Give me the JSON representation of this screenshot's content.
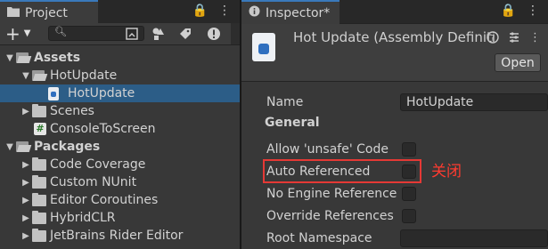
{
  "project": {
    "tab_label": "Project",
    "tab_tools": [
      "🔒",
      "⋮"
    ],
    "add_label": "+",
    "search": {
      "value": "",
      "placeholder": ""
    },
    "badge_count": "",
    "tree": [
      {
        "label": "Assets",
        "bold": true,
        "expanded": true,
        "icon": "folder-open"
      },
      {
        "label": "HotUpdate",
        "bold": false,
        "expanded": true,
        "icon": "folder-open"
      },
      {
        "label": "HotUpdate",
        "bold": false,
        "expanded": false,
        "icon": "assembly-definition-icon",
        "selected": true
      },
      {
        "label": "Scenes",
        "bold": false,
        "expanded": false,
        "icon": "folder"
      },
      {
        "label": "ConsoleToScreen",
        "bold": false,
        "expanded": false,
        "icon": "csharp-script-icon"
      },
      {
        "label": "Packages",
        "bold": true,
        "expanded": true,
        "icon": "folder-open"
      },
      {
        "label": "Code Coverage",
        "bold": false,
        "expanded": false,
        "icon": "folder"
      },
      {
        "label": "Custom NUnit",
        "bold": false,
        "expanded": false,
        "icon": "folder"
      },
      {
        "label": "Editor Coroutines",
        "bold": false,
        "expanded": false,
        "icon": "folder"
      },
      {
        "label": "HybridCLR",
        "bold": false,
        "expanded": false,
        "icon": "folder"
      },
      {
        "label": "JetBrains Rider Editor",
        "bold": false,
        "expanded": false,
        "icon": "folder"
      }
    ]
  },
  "inspector": {
    "tab_label": "Inspector*",
    "title": "Hot Update (Assembly Definiti",
    "open_label": "Open",
    "name_label": "Name",
    "name_value": "HotUpdate",
    "section_general": "General",
    "allow_unsafe_label": "Allow 'unsafe' Code",
    "auto_referenced_label": "Auto Referenced",
    "no_engine_label": "No Engine Reference",
    "override_refs_label": "Override References",
    "root_ns_label": "Root Namespace",
    "root_ns_value": "",
    "annotation": "关闭",
    "highlight_color": "#e53935"
  }
}
